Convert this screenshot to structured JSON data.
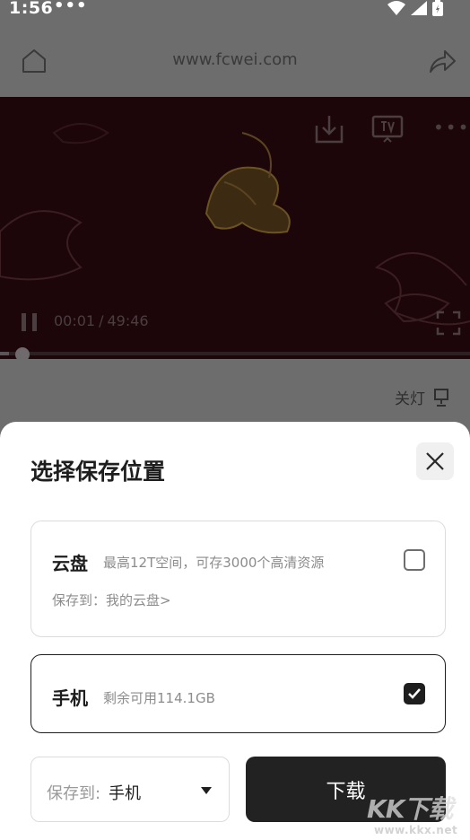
{
  "status_bar": {
    "time": "1:56",
    "dots": "•••"
  },
  "nav": {
    "url": "www.fcwei.com"
  },
  "player": {
    "current_time": "00:01",
    "separator": "/",
    "duration": "49:46",
    "progress_fraction": 0.02
  },
  "lights_label": "关灯",
  "sheet": {
    "title": "选择保存位置",
    "options": [
      {
        "name": "云盘",
        "desc": "最高12T空间，可存3000个高清资源",
        "sub": "保存到：我的云盘>",
        "checked": false
      },
      {
        "name": "手机",
        "desc": "剩余可用114.1GB",
        "checked": true
      }
    ],
    "save_to_prefix": "保存到:",
    "save_to_value": "手机",
    "download_label": "下载"
  },
  "watermark": {
    "big": "KK下载",
    "small": "www.kkx.net"
  },
  "colors": {
    "primary_button": "#222222",
    "overlay": "#6d6d6d",
    "video_bg": "#1d0609"
  }
}
